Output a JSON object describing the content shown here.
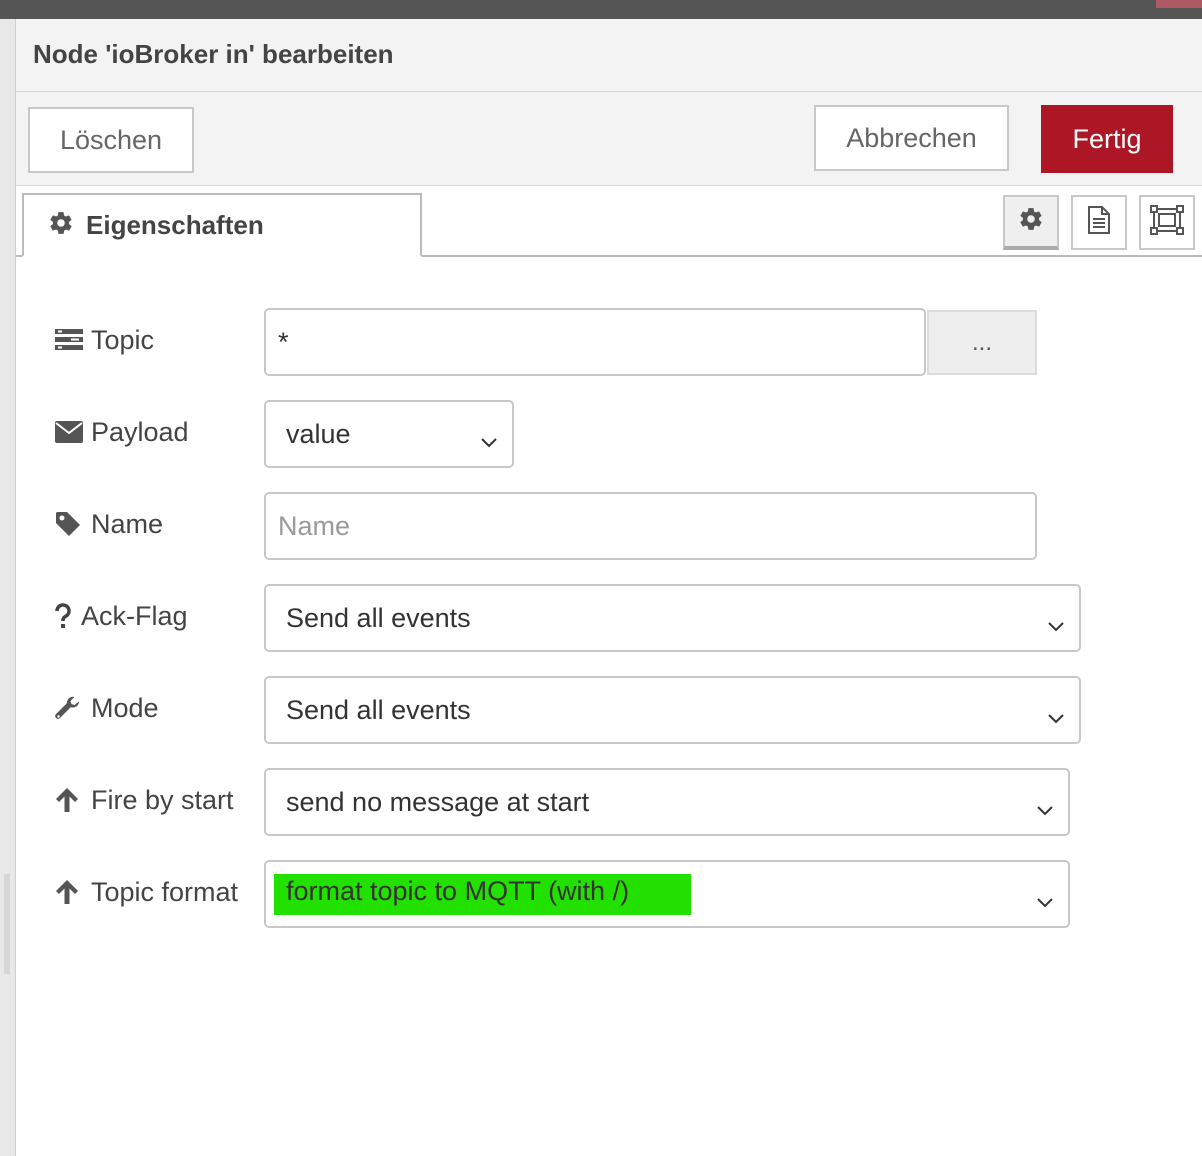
{
  "window": {
    "accent_color": "#ad5a64",
    "topbar_color": "#555555"
  },
  "tray": {
    "title": "Node 'ioBroker in' bearbeiten",
    "buttons": {
      "delete": "Löschen",
      "cancel": "Abbrechen",
      "done": "Fertig",
      "done_color": "#ad1625"
    }
  },
  "tabs": {
    "properties": {
      "label": "Eigenschaften",
      "icon": "gear-icon"
    },
    "icon_buttons": [
      {
        "icon": "gear-icon",
        "active": true
      },
      {
        "icon": "description-icon",
        "active": false
      },
      {
        "icon": "appearance-icon",
        "active": false
      }
    ]
  },
  "form": {
    "topic": {
      "label": "Topic",
      "icon": "tasks-icon",
      "value": "*",
      "browse_label": "..."
    },
    "payload": {
      "label": "Payload",
      "icon": "envelope-icon",
      "selected": "value"
    },
    "name": {
      "label": "Name",
      "icon": "tag-icon",
      "value": "",
      "placeholder": "Name"
    },
    "ack_flag": {
      "label": "Ack-Flag",
      "icon": "question-icon",
      "selected": "Send all events"
    },
    "mode": {
      "label": "Mode",
      "icon": "wrench-icon",
      "selected": "Send all events"
    },
    "fire_by_start": {
      "label": "Fire by start",
      "icon": "arrow-up-icon",
      "selected": "send no message at start"
    },
    "topic_format": {
      "label": "Topic format",
      "icon": "arrow-up-icon",
      "selected": "format topic to MQTT (with /)",
      "highlight_color": "#22e000"
    }
  }
}
